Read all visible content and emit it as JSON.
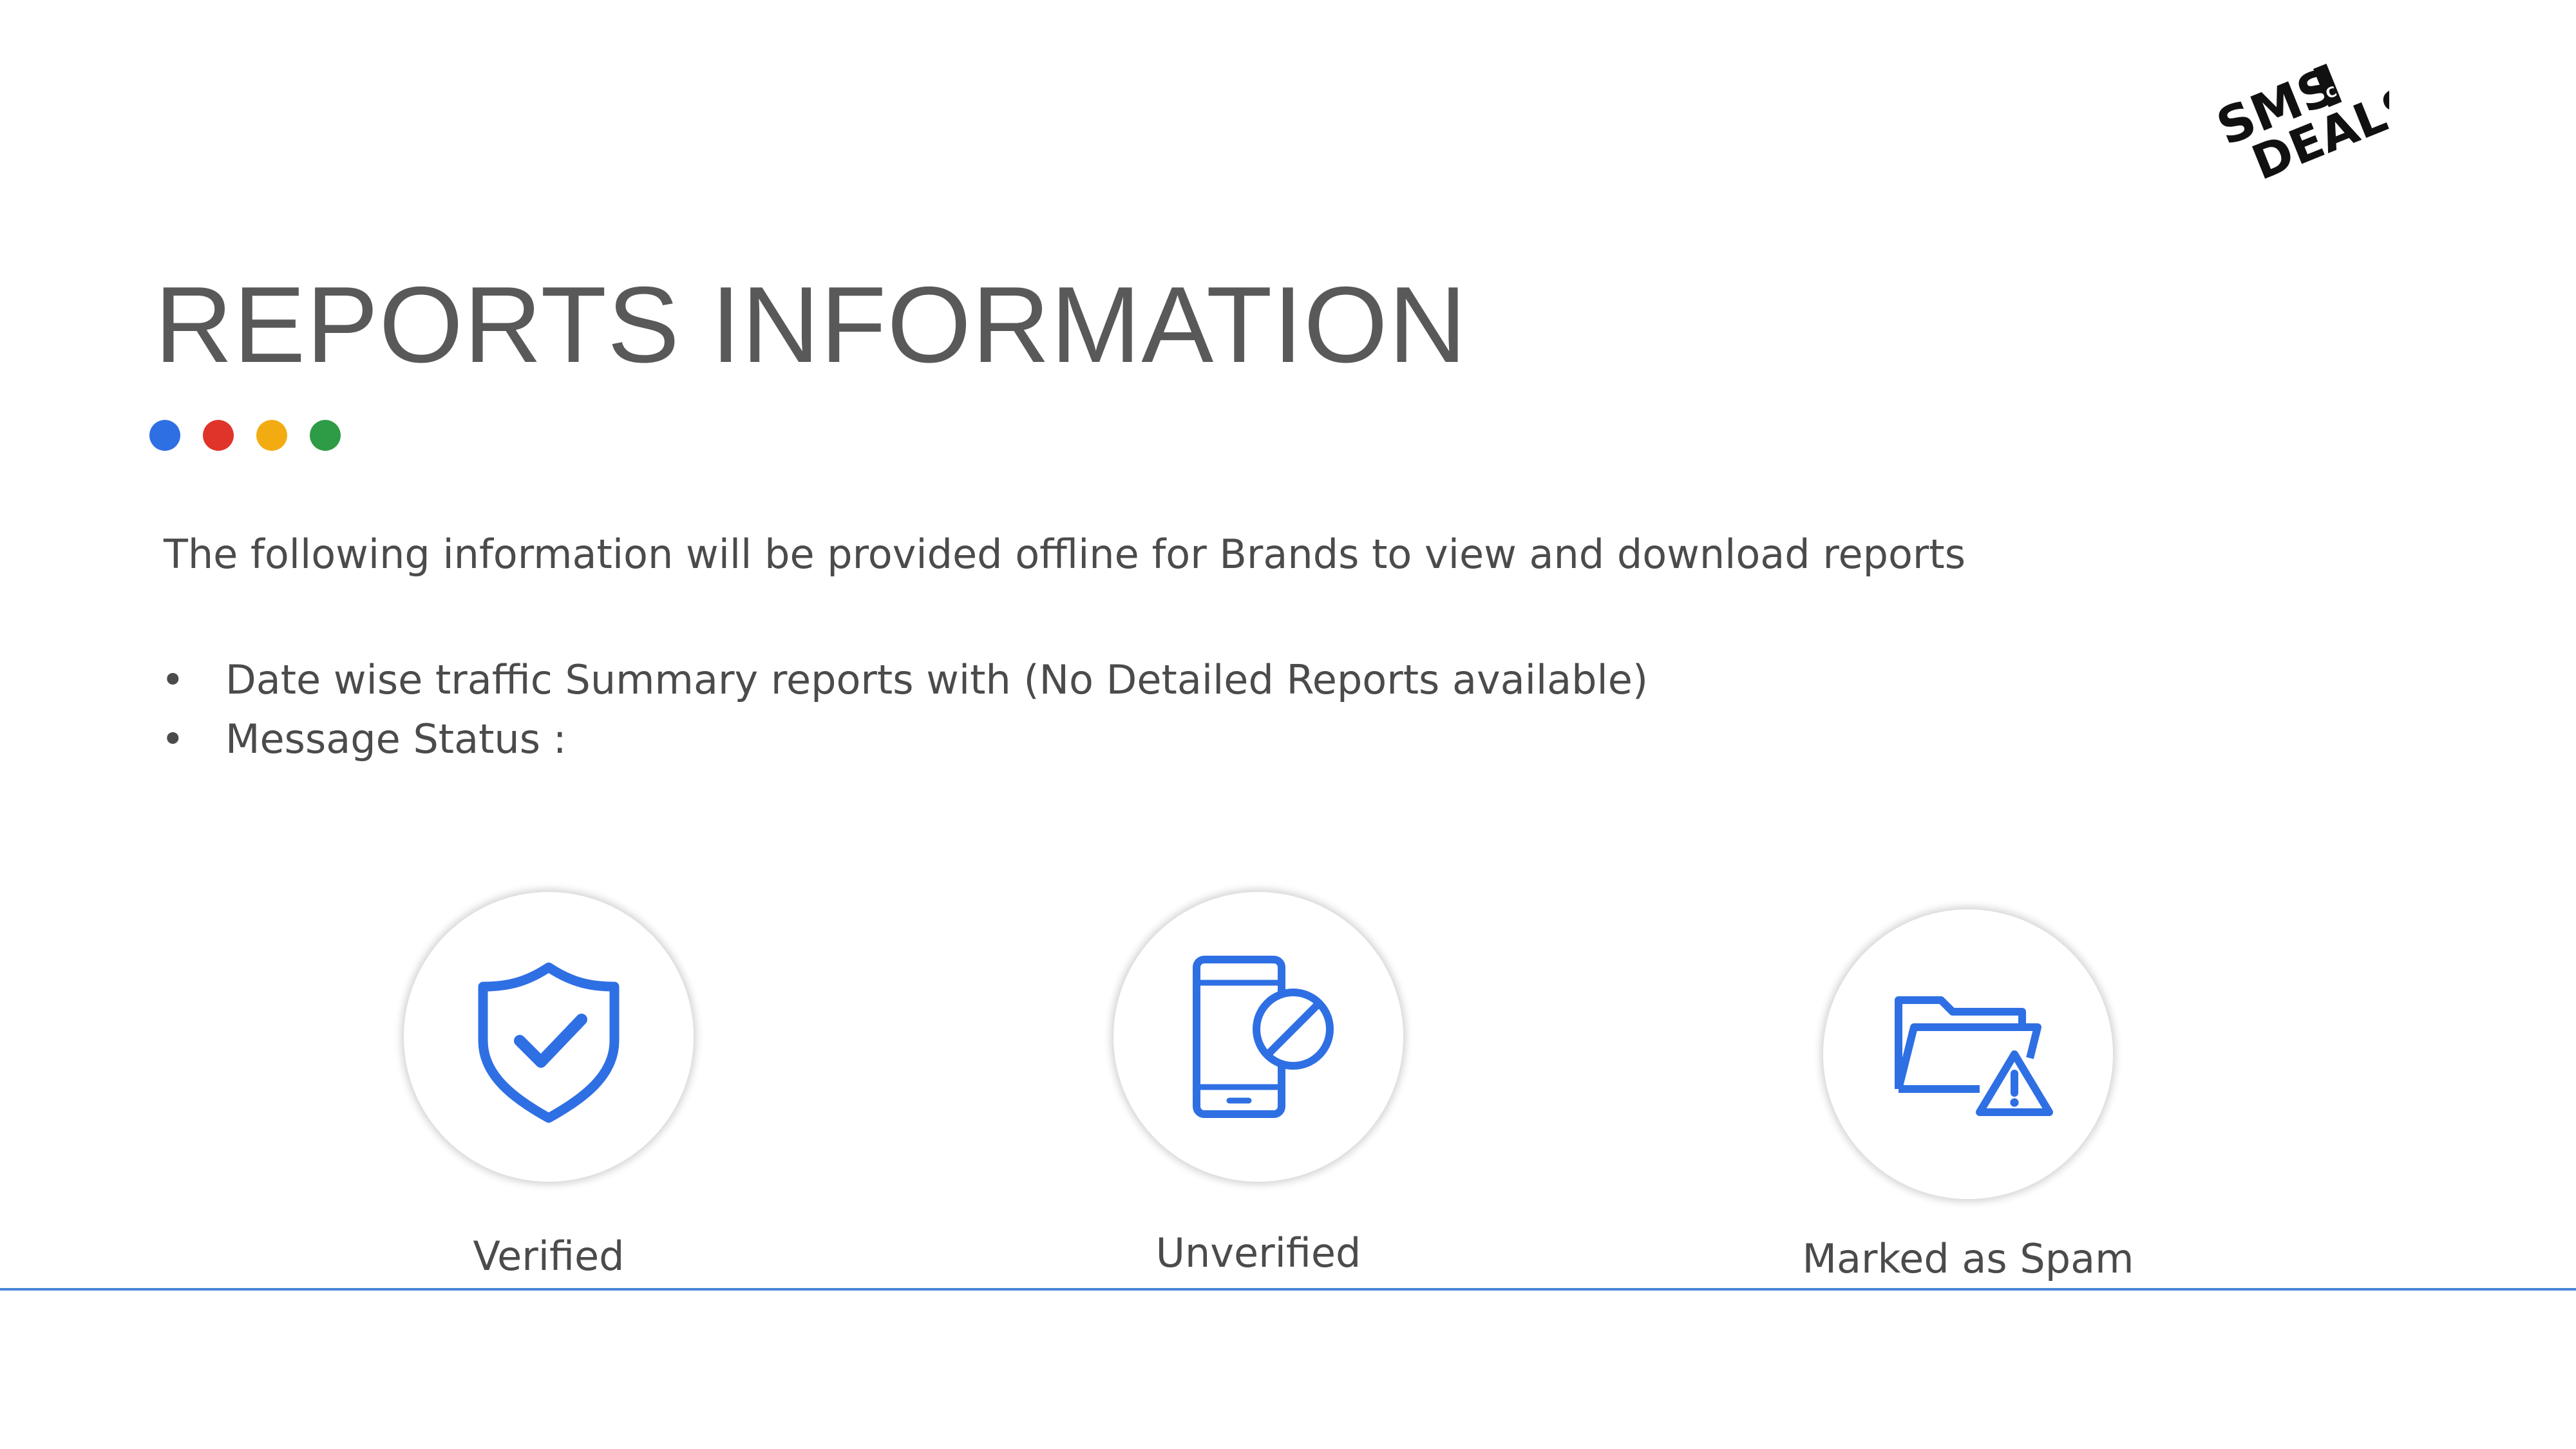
{
  "title": "REPORTS INFORMATION",
  "dots": [
    "#2f6fe4",
    "#e0342b",
    "#f2ac12",
    "#2e9c46"
  ],
  "logo": {
    "line1": "SMS",
    "line2": "DEALS",
    "overlay": "C"
  },
  "intro": "The following information will be provided offline for Brands to view and download reports",
  "bullets": [
    "Date wise traffic Summary reports with (No Detailed Reports available)",
    "Message Status :"
  ],
  "bullet_symbol": "•",
  "statuses": [
    {
      "label": "Verified",
      "icon": "shield-check-icon"
    },
    {
      "label": "Unverified",
      "icon": "phone-blocked-icon"
    },
    {
      "label": "Marked as Spam",
      "icon": "folder-warning-icon"
    }
  ],
  "colors": {
    "icon": "#2f6fe4",
    "title": "#595959",
    "text": "#4b4b4b",
    "line": "#4a86d8"
  }
}
